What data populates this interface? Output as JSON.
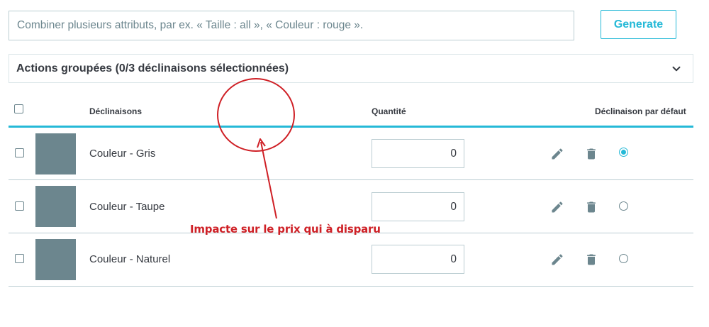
{
  "attributes": {
    "placeholder": "Combiner plusieurs attributs, par ex. « Taille : all », « Couleur : rouge ».",
    "generate_label": "Generate"
  },
  "bulk_actions": {
    "title": "Actions groupées (0/3 déclinaisons sélectionnées)"
  },
  "table": {
    "headers": {
      "combinations": "Déclinaisons",
      "quantity": "Quantité",
      "default": "Déclinaison par défaut"
    },
    "rows": [
      {
        "label": "Couleur - Gris",
        "quantity": "0",
        "is_default": true
      },
      {
        "label": "Couleur - Taupe",
        "quantity": "0",
        "is_default": false
      },
      {
        "label": "Couleur - Naturel",
        "quantity": "0",
        "is_default": false
      }
    ]
  },
  "annotation": {
    "text": "Impacte sur le prix qui à disparu"
  },
  "colors": {
    "accent": "#25b9d7",
    "annotation": "#cf2026",
    "thumbnail": "#6c868e"
  },
  "icons": {
    "edit": "pencil-icon",
    "delete": "trash-icon",
    "expand": "chevron-down-icon"
  }
}
